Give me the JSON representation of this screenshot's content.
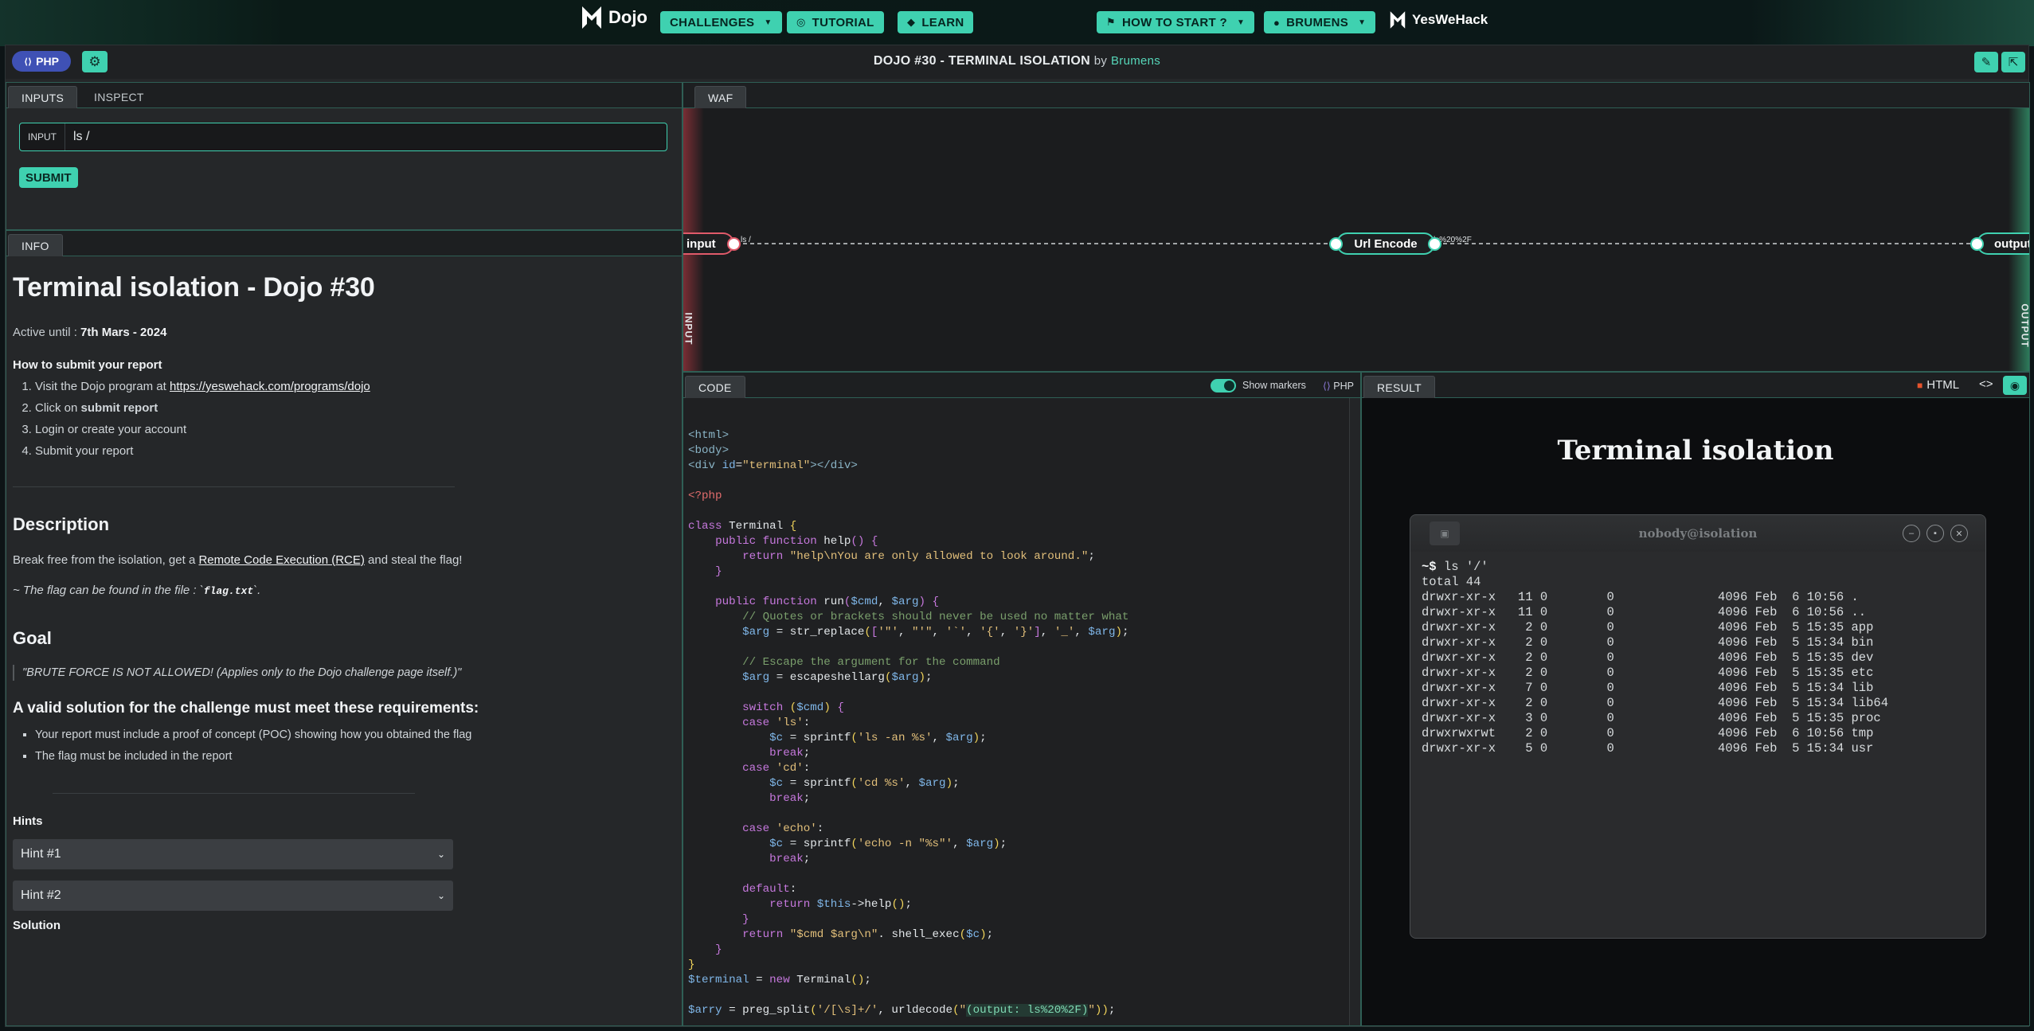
{
  "nav": {
    "dojo_label": "Dojo",
    "challenges": "CHALLENGES",
    "tutorial": "TUTORIAL",
    "learn": "LEARN",
    "how_to_start": "HOW TO START ?",
    "user": "BRUMENS",
    "ywh_label": "YesWeHack"
  },
  "title": {
    "lang": "PHP",
    "challenge": "DOJO #30 - TERMINAL ISOLATION",
    "by": "by",
    "author": "Brumens"
  },
  "inputs_panel": {
    "tabs": [
      "INPUTS",
      "INSPECT"
    ],
    "input_label": "INPUT",
    "input_value": "ls /",
    "submit": "SUBMIT"
  },
  "info_panel": {
    "tab": "INFO",
    "heading": "Terminal isolation - Dojo #30",
    "active_prefix": "Active until : ",
    "active_date": "7th Mars - 2024",
    "how_to_title": "How to submit your report",
    "steps": {
      "s1_prefix": "Visit the Dojo program at ",
      "s1_link": "https://yeswehack.com/programs/dojo",
      "s2_prefix": "Click on ",
      "s2_bold": "submit report",
      "s3": "Login or create your account",
      "s4": "Submit your report"
    },
    "description_title": "Description",
    "description_prefix": "Break free from the isolation, get a ",
    "description_link": "Remote Code Execution (RCE)",
    "description_suffix": " and steal the flag!",
    "flag_note_prefix": "~ The flag can be found in the file : `",
    "flag_file": "flag.txt",
    "flag_note_suffix": "`.",
    "goal_title": "Goal",
    "goal_quote": "\"BRUTE FORCE IS NOT ALLOWED! (Applies only to the Dojo challenge page itself.)\"",
    "requirements_title": "A valid solution for the challenge must meet these requirements:",
    "req1": "Your report must include a proof of concept (POC) showing how you obtained the flag",
    "req2": "The flag must be included in the report",
    "hints_title": "Hints",
    "hint1": "Hint #1",
    "hint2": "Hint #2",
    "solution_title": "Solution"
  },
  "waf": {
    "tab": "WAF",
    "input_node": "input",
    "url_node": "Url Encode",
    "output_node": "output",
    "edge1": "ls /",
    "edge2": "ls%20%2F",
    "side_input": "INPUT",
    "side_output": "OUTPUT"
  },
  "code_panel": {
    "tab": "CODE",
    "show_markers": "Show markers",
    "lang": "PHP"
  },
  "result_panel": {
    "tab": "RESULT",
    "format": "HTML",
    "page_heading": "Terminal isolation",
    "terminal_title": "nobody@isolation",
    "prompt": "~$",
    "command": " ls '/'",
    "output": "total 44\ndrwxr-xr-x   11 0        0              4096 Feb  6 10:56 .\ndrwxr-xr-x   11 0        0              4096 Feb  6 10:56 ..\ndrwxr-xr-x    2 0        0              4096 Feb  5 15:35 app\ndrwxr-xr-x    2 0        0              4096 Feb  5 15:34 bin\ndrwxr-xr-x    2 0        0              4096 Feb  5 15:35 dev\ndrwxr-xr-x    2 0        0              4096 Feb  5 15:35 etc\ndrwxr-xr-x    7 0        0              4096 Feb  5 15:34 lib\ndrwxr-xr-x    2 0        0              4096 Feb  5 15:34 lib64\ndrwxr-xr-x    3 0        0              4096 Feb  5 15:35 proc\ndrwxrwxrwt    2 0        0              4096 Feb  6 10:56 tmp\ndrwxr-xr-x    5 0        0              4096 Feb  5 15:34 usr"
  },
  "colors": {
    "accent": "#3fd1b0",
    "php_pill": "#3f51b5",
    "input_node_border": "#e05a6a"
  },
  "icons": [
    "dojo-logo-icon",
    "shield-icon",
    "graduation-icon",
    "flag-icon",
    "user-icon",
    "ywh-logo-icon",
    "gear-icon",
    "edit-icon",
    "share-icon",
    "eye-icon",
    "code-icon",
    "chevron-down-icon",
    "terminal-icon",
    "minimize-icon",
    "maximize-icon",
    "close-icon",
    "html5-icon"
  ]
}
